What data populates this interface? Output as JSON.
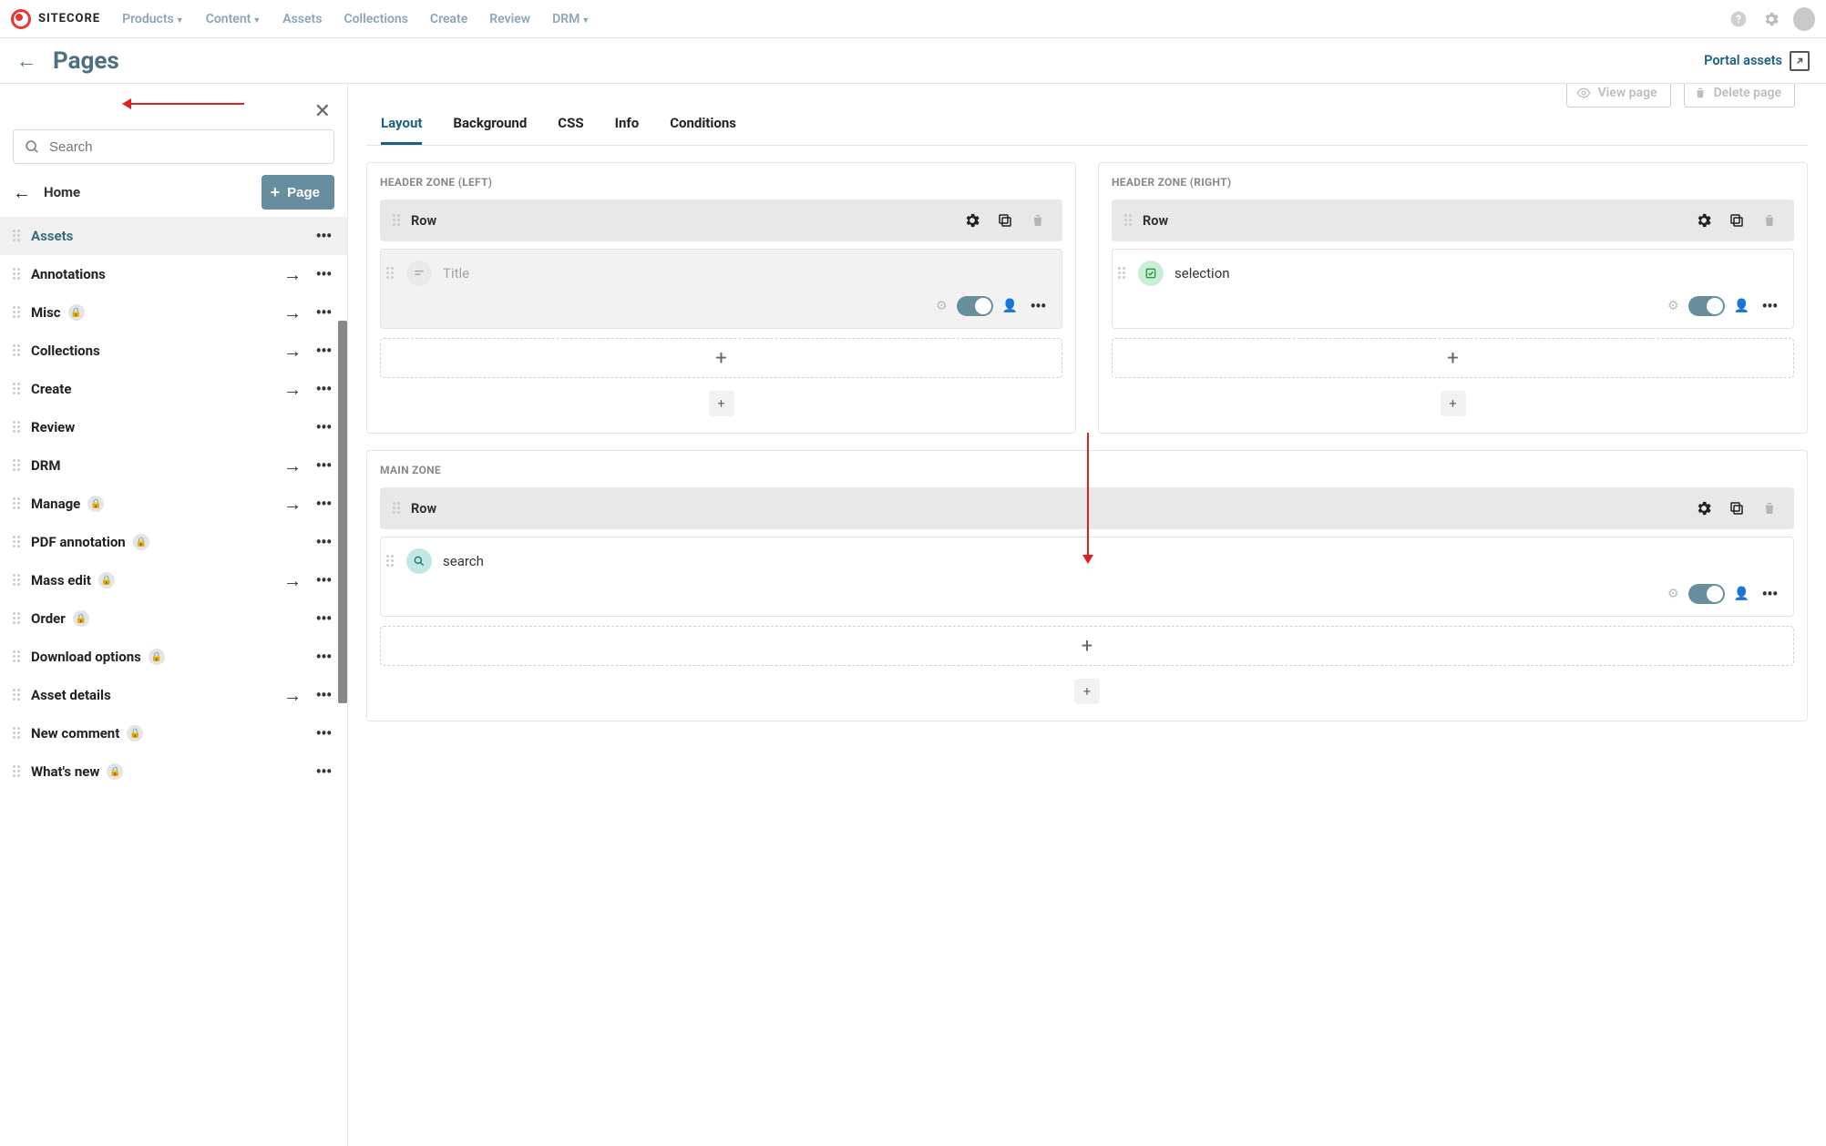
{
  "brand": "SITECORE",
  "nav": {
    "items": [
      {
        "label": "Products",
        "chev": true
      },
      {
        "label": "Content",
        "chev": true
      },
      {
        "label": "Assets",
        "chev": false
      },
      {
        "label": "Collections",
        "chev": false
      },
      {
        "label": "Create",
        "chev": false
      },
      {
        "label": "Review",
        "chev": false
      },
      {
        "label": "DRM",
        "chev": true
      }
    ]
  },
  "subbar": {
    "title": "Pages",
    "portal_label": "Portal assets"
  },
  "sidebar": {
    "search_placeholder": "Search",
    "home_label": "Home",
    "page_btn_label": "Page",
    "items": [
      {
        "label": "Assets",
        "lock": false,
        "chev": false,
        "active": true
      },
      {
        "label": "Annotations",
        "lock": false,
        "chev": true,
        "active": false
      },
      {
        "label": "Misc",
        "lock": true,
        "chev": true,
        "active": false
      },
      {
        "label": "Collections",
        "lock": false,
        "chev": true,
        "active": false
      },
      {
        "label": "Create",
        "lock": false,
        "chev": true,
        "active": false
      },
      {
        "label": "Review",
        "lock": false,
        "chev": false,
        "active": false
      },
      {
        "label": "DRM",
        "lock": false,
        "chev": true,
        "active": false
      },
      {
        "label": "Manage",
        "lock": true,
        "chev": true,
        "active": false
      },
      {
        "label": "PDF annotation",
        "lock": true,
        "chev": false,
        "active": false
      },
      {
        "label": "Mass edit",
        "lock": true,
        "chev": true,
        "active": false
      },
      {
        "label": "Order",
        "lock": true,
        "chev": false,
        "active": false
      },
      {
        "label": "Download options",
        "lock": true,
        "chev": false,
        "active": false
      },
      {
        "label": "Asset details",
        "lock": false,
        "chev": true,
        "active": false
      },
      {
        "label": "New comment",
        "lock": true,
        "chev": false,
        "active": false
      },
      {
        "label": "What's new",
        "lock": true,
        "chev": false,
        "active": false
      }
    ]
  },
  "editor": {
    "top_buttons": {
      "view_label": "View page",
      "delete_label": "Delete page"
    },
    "tabs": [
      "Layout",
      "Background",
      "CSS",
      "Info",
      "Conditions"
    ],
    "active_tab": "Layout",
    "zones": {
      "header_left": {
        "title": "HEADER ZONE (LEFT)",
        "row_label": "Row",
        "card_label": "Title"
      },
      "header_right": {
        "title": "HEADER ZONE (RIGHT)",
        "row_label": "Row",
        "card_label": "selection"
      },
      "main": {
        "title": "MAIN ZONE",
        "row_label": "Row",
        "card_label": "search"
      }
    }
  }
}
